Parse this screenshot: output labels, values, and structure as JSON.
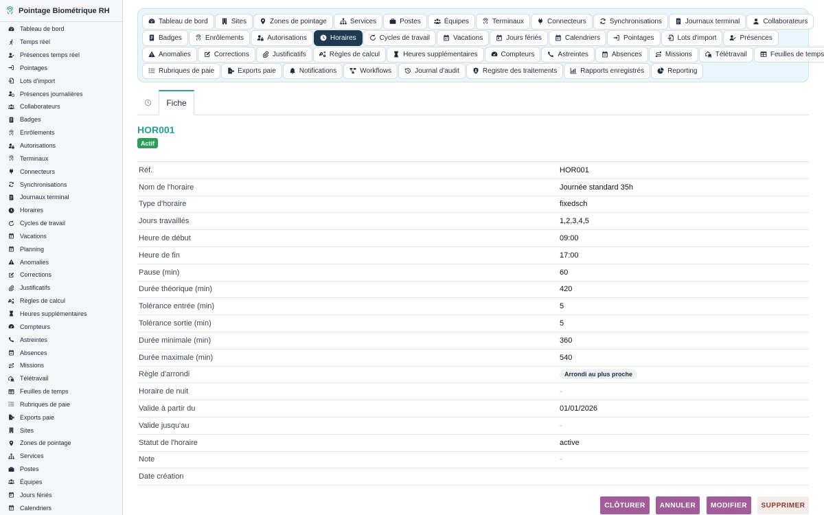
{
  "app": {
    "title": "Pointage Biométrique RH"
  },
  "sidebar": {
    "items": [
      {
        "label": "Tableau de bord",
        "icon": "dashboard-icon"
      },
      {
        "label": "Temps réel",
        "icon": "running-icon"
      },
      {
        "label": "Présences temps réel",
        "icon": "user-check-icon"
      },
      {
        "label": "Pointages",
        "icon": "sign-in-icon"
      },
      {
        "label": "Lots d'import",
        "icon": "file-import-icon"
      },
      {
        "label": "Présences journalières",
        "icon": "user-clock-icon"
      },
      {
        "label": "Collaborateurs",
        "icon": "users-icon"
      },
      {
        "label": "Badges",
        "icon": "badge-icon"
      },
      {
        "label": "Enrôlements",
        "icon": "fingerprint-icon"
      },
      {
        "label": "Autorisations",
        "icon": "user-lock-icon"
      },
      {
        "label": "Terminaux",
        "icon": "fingerprint-icon"
      },
      {
        "label": "Connecteurs",
        "icon": "plug-icon"
      },
      {
        "label": "Synchronisations",
        "icon": "sync-icon"
      },
      {
        "label": "Journaux terminal",
        "icon": "log-icon"
      },
      {
        "label": "Horaires",
        "icon": "clock-icon"
      },
      {
        "label": "Cycles de travail",
        "icon": "rotate-icon"
      },
      {
        "label": "Vacations",
        "icon": "calendar-icon"
      },
      {
        "label": "Planning",
        "icon": "calendar-icon"
      },
      {
        "label": "Anomalies",
        "icon": "warning-icon"
      },
      {
        "label": "Corrections",
        "icon": "edit-icon"
      },
      {
        "label": "Justificatifs",
        "icon": "paperclip-icon"
      },
      {
        "label": "Règles de calcul",
        "icon": "cogs-icon"
      },
      {
        "label": "Heures supplémentaires",
        "icon": "hourglass-icon"
      },
      {
        "label": "Compteurs",
        "icon": "gauge-icon"
      },
      {
        "label": "Astreintes",
        "icon": "phone-icon"
      },
      {
        "label": "Absences",
        "icon": "calendar-minus-icon"
      },
      {
        "label": "Missions",
        "icon": "route-icon"
      },
      {
        "label": "Télétravail",
        "icon": "house-laptop-icon"
      },
      {
        "label": "Feuilles de temps",
        "icon": "table-icon"
      },
      {
        "label": "Rubriques de paie",
        "icon": "list-icon"
      },
      {
        "label": "Exports paie",
        "icon": "file-export-icon"
      },
      {
        "label": "Sites",
        "icon": "building-icon"
      },
      {
        "label": "Zones de pointage",
        "icon": "map-pin-icon"
      },
      {
        "label": "Services",
        "icon": "sitemap-icon"
      },
      {
        "label": "Postes",
        "icon": "briefcase-icon"
      },
      {
        "label": "Équipes",
        "icon": "users-icon"
      },
      {
        "label": "Jours fériés",
        "icon": "calendar-day-icon"
      },
      {
        "label": "Calendriers",
        "icon": "calendar-icon"
      }
    ]
  },
  "topnav": {
    "rows": [
      [
        {
          "label": "Tableau de bord",
          "icon": "dashboard-icon"
        },
        {
          "label": "Sites",
          "icon": "building-icon"
        },
        {
          "label": "Zones de pointage",
          "icon": "map-pin-icon"
        },
        {
          "label": "Services",
          "icon": "sitemap-icon"
        },
        {
          "label": "Postes",
          "icon": "briefcase-icon"
        },
        {
          "label": "Équipes",
          "icon": "users-icon"
        },
        {
          "label": "Terminaux",
          "icon": "fingerprint-icon"
        },
        {
          "label": "Connecteurs",
          "icon": "plug-icon"
        },
        {
          "label": "Synchronisations",
          "icon": "sync-icon"
        },
        {
          "label": "Journaux terminal",
          "icon": "log-icon"
        },
        {
          "label": "Collaborateurs",
          "icon": "user-icon"
        }
      ],
      [
        {
          "label": "Badges",
          "icon": "badge-icon"
        },
        {
          "label": "Enrôlements",
          "icon": "fingerprint-icon"
        },
        {
          "label": "Autorisations",
          "icon": "user-lock-icon"
        },
        {
          "label": "Horaires",
          "icon": "clock-icon",
          "active": true
        },
        {
          "label": "Cycles de travail",
          "icon": "rotate-icon"
        },
        {
          "label": "Vacations",
          "icon": "calendar-icon"
        },
        {
          "label": "Jours fériés",
          "icon": "calendar-day-icon"
        },
        {
          "label": "Calendriers",
          "icon": "calendar-icon"
        },
        {
          "label": "Pointages",
          "icon": "sign-in-icon"
        },
        {
          "label": "Lots d'import",
          "icon": "file-import-icon"
        },
        {
          "label": "Présences",
          "icon": "user-check-icon"
        }
      ],
      [
        {
          "label": "Anomalies",
          "icon": "warning-icon"
        },
        {
          "label": "Corrections",
          "icon": "edit-icon"
        },
        {
          "label": "Justificatifs",
          "icon": "paperclip-icon"
        },
        {
          "label": "Règles de calcul",
          "icon": "cogs-icon"
        },
        {
          "label": "Heures supplémentaires",
          "icon": "hourglass-icon"
        },
        {
          "label": "Compteurs",
          "icon": "gauge-icon"
        },
        {
          "label": "Astreintes",
          "icon": "phone-icon"
        },
        {
          "label": "Absences",
          "icon": "calendar-minus-icon"
        },
        {
          "label": "Missions",
          "icon": "route-icon"
        },
        {
          "label": "Télétravail",
          "icon": "house-laptop-icon"
        },
        {
          "label": "Feuilles de temps",
          "icon": "table-icon"
        }
      ],
      [
        {
          "label": "Rubriques de paie",
          "icon": "list-icon"
        },
        {
          "label": "Exports paie",
          "icon": "file-export-icon"
        },
        {
          "label": "Notifications",
          "icon": "bell-icon"
        },
        {
          "label": "Workflows",
          "icon": "workflow-icon"
        },
        {
          "label": "Journal d'audit",
          "icon": "history-icon"
        },
        {
          "label": "Registre des traitements",
          "icon": "user-shield-icon"
        },
        {
          "label": "Rapports enregistrés",
          "icon": "chart-icon"
        },
        {
          "label": "Reporting",
          "icon": "pie-chart-icon"
        }
      ]
    ]
  },
  "tabs": {
    "history_icon": "history-icon",
    "fiche": "Fiche"
  },
  "record": {
    "ref": "HOR001",
    "status_badge": "Actif"
  },
  "details": [
    {
      "label": "Réf.",
      "value": "HOR001"
    },
    {
      "label": "Nom de l'horaire",
      "value": "Journée standard 35h"
    },
    {
      "label": "Type d'horaire",
      "value": "fixedsch"
    },
    {
      "label": "Jours travaillés",
      "value": "1,2,3,4,5"
    },
    {
      "label": "Heure de début",
      "value": "09:00"
    },
    {
      "label": "Heure de fin",
      "value": "17:00"
    },
    {
      "label": "Pause (min)",
      "value": "60"
    },
    {
      "label": "Durée théorique (min)",
      "value": "420"
    },
    {
      "label": "Tolérance entrée (min)",
      "value": "5"
    },
    {
      "label": "Tolérance sortie (min)",
      "value": "5"
    },
    {
      "label": "Durée minimale (min)",
      "value": "360"
    },
    {
      "label": "Durée maximale (min)",
      "value": "540"
    },
    {
      "label": "Règle d'arrondi",
      "value": "Arrondi au plus proche",
      "pill": true
    },
    {
      "label": "Horaire de nuit",
      "value": "-",
      "muted": true
    },
    {
      "label": "Valide à partir du",
      "value": "01/01/2026"
    },
    {
      "label": "Valide jusqu'au",
      "value": "-",
      "muted": true
    },
    {
      "label": "Statut de l'horaire",
      "value": "active"
    },
    {
      "label": "Note",
      "value": "-",
      "muted": true
    },
    {
      "label": "Date création",
      "value": ""
    }
  ],
  "actions": {
    "close": "CLÔTURER",
    "cancel": "ANNULER",
    "edit": "MODIFIER",
    "delete": "SUPPRIMER"
  },
  "colors": {
    "accent": "#2a9d8f",
    "active_nav": "#1f3a52",
    "action_button": "#a25c9c",
    "status_green": "#2e9e56",
    "danger_text": "#8b3a2a"
  }
}
